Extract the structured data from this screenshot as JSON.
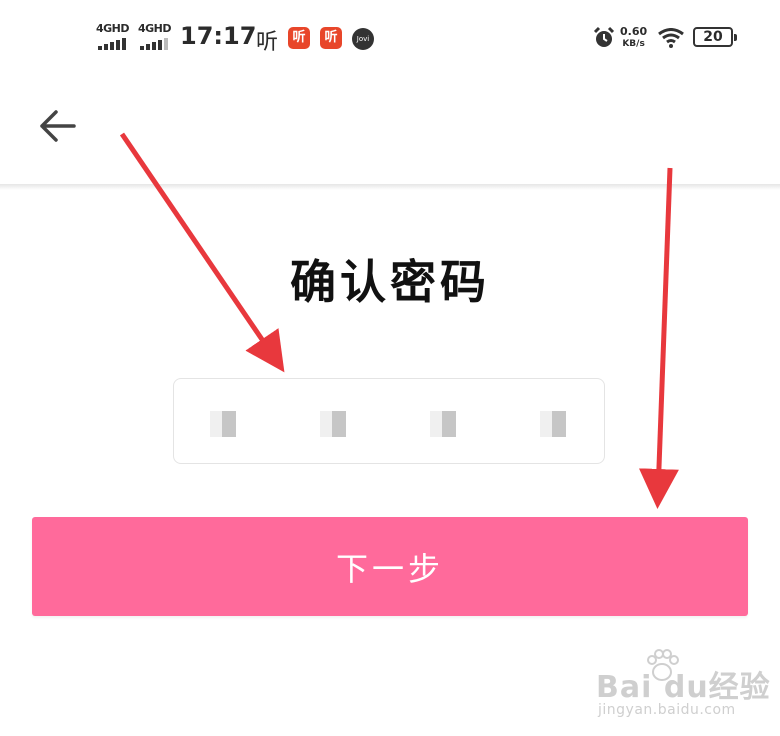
{
  "status_bar": {
    "signal1_label": "4GHD",
    "signal2_label": "4GHD",
    "time": "17:17",
    "app_label": "听",
    "badge1": "听",
    "badge2": "听",
    "jovi": "Jovi",
    "speed_value": "0.60",
    "speed_unit": "KB/s",
    "battery": "20"
  },
  "page": {
    "title": "确认密码"
  },
  "pin": {
    "digits_entered": 4
  },
  "actions": {
    "next_label": "下一步"
  },
  "colors": {
    "primary_button": "#ff6a9b",
    "arrow": "#e8383d"
  },
  "watermark": {
    "main": "Bai du经验",
    "url": "jingyan.baidu.com"
  }
}
